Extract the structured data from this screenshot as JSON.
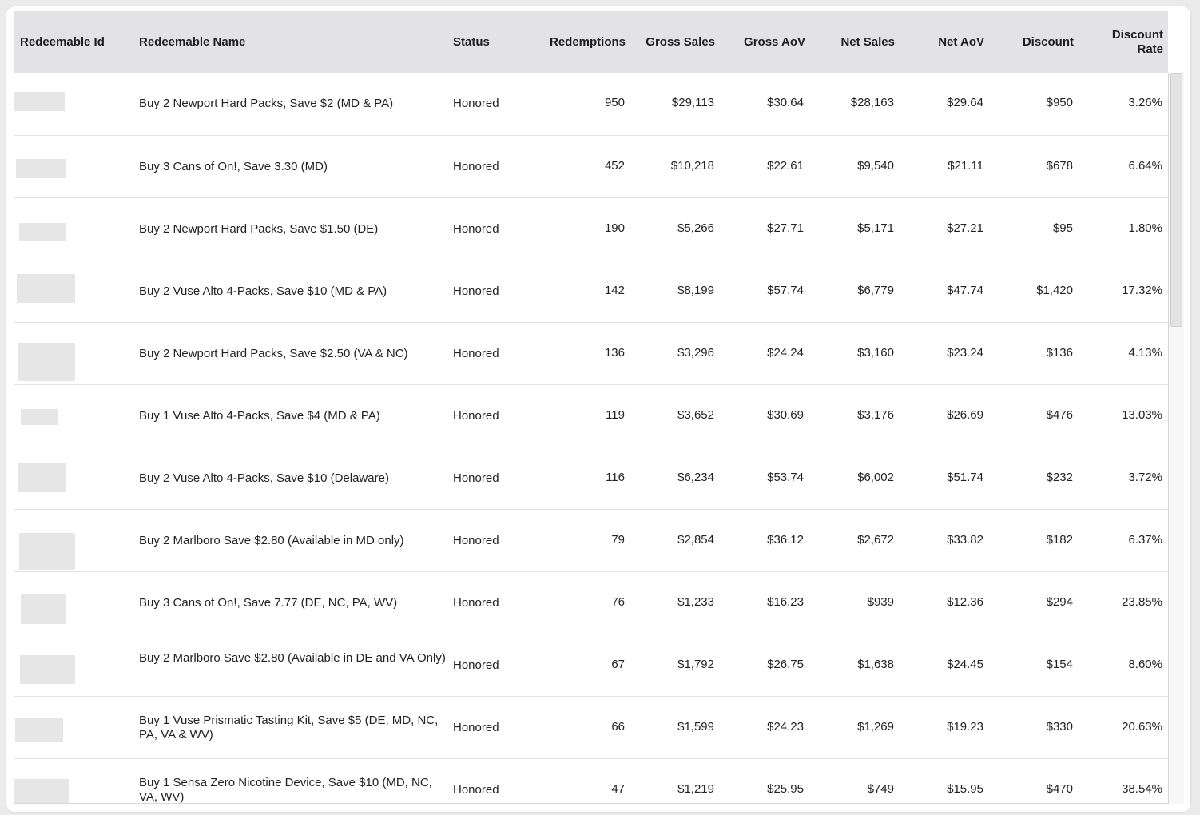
{
  "table": {
    "columns": [
      "Redeemable Id",
      "Redeemable Name",
      "Status",
      "Redemptions",
      "Gross Sales",
      "Gross AoV",
      "Net Sales",
      "Net AoV",
      "Discount",
      "Discount Rate"
    ],
    "rows": [
      {
        "name": "Buy 2 Newport Hard Packs, Save $2 (MD & PA)",
        "status": "Honored",
        "redemptions": "950",
        "gross_sales": "$29,113",
        "gross_aov": "$30.64",
        "net_sales": "$28,163",
        "net_aov": "$29.64",
        "discount": "$950",
        "discount_rate": "3.26%"
      },
      {
        "name": "Buy 3 Cans of On!, Save 3.30 (MD)",
        "status": "Honored",
        "redemptions": "452",
        "gross_sales": "$10,218",
        "gross_aov": "$22.61",
        "net_sales": "$9,540",
        "net_aov": "$21.11",
        "discount": "$678",
        "discount_rate": "6.64%"
      },
      {
        "name": "Buy 2 Newport Hard Packs, Save $1.50 (DE)",
        "status": "Honored",
        "redemptions": "190",
        "gross_sales": "$5,266",
        "gross_aov": "$27.71",
        "net_sales": "$5,171",
        "net_aov": "$27.21",
        "discount": "$95",
        "discount_rate": "1.80%"
      },
      {
        "name": "Buy 2 Vuse Alto 4-Packs, Save $10 (MD & PA)",
        "status": "Honored",
        "redemptions": "142",
        "gross_sales": "$8,199",
        "gross_aov": "$57.74",
        "net_sales": "$6,779",
        "net_aov": "$47.74",
        "discount": "$1,420",
        "discount_rate": "17.32%"
      },
      {
        "name": "Buy 2 Newport Hard Packs, Save $2.50 (VA & NC)",
        "status": "Honored",
        "redemptions": "136",
        "gross_sales": "$3,296",
        "gross_aov": "$24.24",
        "net_sales": "$3,160",
        "net_aov": "$23.24",
        "discount": "$136",
        "discount_rate": "4.13%"
      },
      {
        "name": "Buy 1 Vuse Alto 4-Packs, Save $4 (MD & PA)",
        "status": "Honored",
        "redemptions": "119",
        "gross_sales": "$3,652",
        "gross_aov": "$30.69",
        "net_sales": "$3,176",
        "net_aov": "$26.69",
        "discount": "$476",
        "discount_rate": "13.03%"
      },
      {
        "name": "Buy 2 Vuse Alto 4-Packs, Save $10 (Delaware)",
        "status": "Honored",
        "redemptions": "116",
        "gross_sales": "$6,234",
        "gross_aov": "$53.74",
        "net_sales": "$6,002",
        "net_aov": "$51.74",
        "discount": "$232",
        "discount_rate": "3.72%"
      },
      {
        "name": "Buy 2 Marlboro Save $2.80 (Available in MD only)",
        "status": "Honored",
        "redemptions": "79",
        "gross_sales": "$2,854",
        "gross_aov": "$36.12",
        "net_sales": "$2,672",
        "net_aov": "$33.82",
        "discount": "$182",
        "discount_rate": "6.37%"
      },
      {
        "name": "Buy 3 Cans of On!, Save 7.77 (DE, NC, PA, WV)",
        "status": "Honored",
        "redemptions": "76",
        "gross_sales": "$1,233",
        "gross_aov": "$16.23",
        "net_sales": "$939",
        "net_aov": "$12.36",
        "discount": "$294",
        "discount_rate": "23.85%"
      },
      {
        "name": "Buy 2 Marlboro Save $2.80 (Available in DE and VA Only)",
        "status": "Honored",
        "redemptions": "67",
        "gross_sales": "$1,792",
        "gross_aov": "$26.75",
        "net_sales": "$1,638",
        "net_aov": "$24.45",
        "discount": "$154",
        "discount_rate": "8.60%"
      },
      {
        "name": "Buy 1 Vuse Prismatic Tasting Kit, Save $5 (DE, MD, NC, PA, VA & WV)",
        "status": "Honored",
        "redemptions": "66",
        "gross_sales": "$1,599",
        "gross_aov": "$24.23",
        "net_sales": "$1,269",
        "net_aov": "$19.23",
        "discount": "$330",
        "discount_rate": "20.63%"
      },
      {
        "name": "Buy 1 Sensa Zero Nicotine Device, Save $10 (MD, NC, VA, WV)",
        "status": "Honored",
        "redemptions": "47",
        "gross_sales": "$1,219",
        "gross_aov": "$25.95",
        "net_sales": "$749",
        "net_aov": "$15.95",
        "discount": "$470",
        "discount_rate": "38.54%"
      }
    ]
  },
  "colors": {
    "header_bg": "#e3e3e5",
    "redacted_block": "#e6e6e6",
    "row_border": "#e2e2e2"
  }
}
